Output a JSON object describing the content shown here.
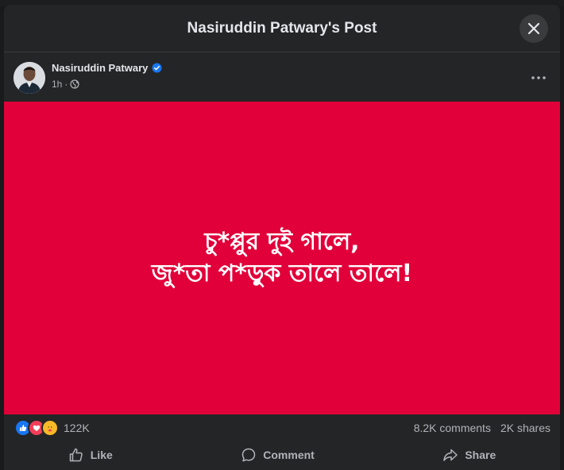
{
  "modal": {
    "title": "Nasiruddin Patwary's Post",
    "close_icon": "close-icon"
  },
  "post": {
    "author": "Nasiruddin Patwary",
    "verified_icon": "verified-badge-icon",
    "time": "1h",
    "separator": "·",
    "audience_icon": "globe-icon",
    "more_icon": "more-options-icon",
    "image_text_line1": "চু*প্পুর দুই গালে,",
    "image_text_line2": "জু*তা প*ড়ুক তালে তালে!",
    "image_bg": "#e1003a"
  },
  "engagement": {
    "reaction_icons": [
      "like-reaction-icon",
      "love-reaction-icon",
      "care-reaction-icon"
    ],
    "reactions_count": "122K",
    "comments": "8.2K comments",
    "shares": "2K shares"
  },
  "actions": {
    "like": "Like",
    "comment": "Comment",
    "share": "Share"
  },
  "colors": {
    "panel": "#242526",
    "accent": "#1877f2",
    "text_secondary": "#b0b3b8"
  }
}
